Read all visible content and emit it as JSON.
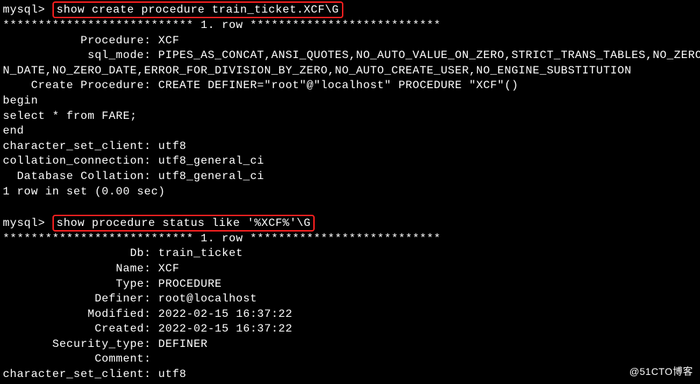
{
  "prompt": "mysql>",
  "cmd1": "show create procedure train_ticket.XCF\\G",
  "row_sep": "*************************** 1. row ***************************",
  "block1": {
    "procedure_label": "           Procedure:",
    "procedure_value": " XCF",
    "sql_mode_label": "            sql_mode:",
    "sql_mode_value_a": " PIPES_AS_CONCAT,ANSI_QUOTES,NO_AUTO_VALUE_ON_ZERO,STRICT_TRANS_TABLES,NO_ZERO_I",
    "sql_mode_value_b": "N_DATE,NO_ZERO_DATE,ERROR_FOR_DIVISION_BY_ZERO,NO_AUTO_CREATE_USER,NO_ENGINE_SUBSTITUTION",
    "create_proc_label": "    Create Procedure:",
    "create_proc_value": " CREATE DEFINER=\"root\"@\"localhost\" PROCEDURE \"XCF\"()",
    "body1": "begin",
    "body2": "select * from FARE;",
    "body3": "end",
    "charset_label": "character_set_client:",
    "charset_value": " utf8",
    "coll_conn_label": "collation_connection:",
    "coll_conn_value": " utf8_general_ci",
    "db_coll_label": "  Database Collation:",
    "db_coll_value": " utf8_general_ci",
    "rows_in_set": "1 row in set (0.00 sec)"
  },
  "cmd2": "show procedure status like '%XCF%'\\G",
  "block2": {
    "db_label": "                  Db:",
    "db_value": " train_ticket",
    "name_label": "                Name:",
    "name_value": " XCF",
    "type_label": "                Type:",
    "type_value": " PROCEDURE",
    "definer_label": "             Definer:",
    "definer_value": " root@localhost",
    "modified_label": "            Modified:",
    "modified_value": " 2022-02-15 16:37:22",
    "created_label": "             Created:",
    "created_value": " 2022-02-15 16:37:22",
    "sectype_label": "       Security_type:",
    "sectype_value": " DEFINER",
    "comment_label": "             Comment:",
    "comment_value": "",
    "charset_label": "character_set_client:",
    "charset_value": " utf8"
  },
  "watermark": "@51CTO博客"
}
